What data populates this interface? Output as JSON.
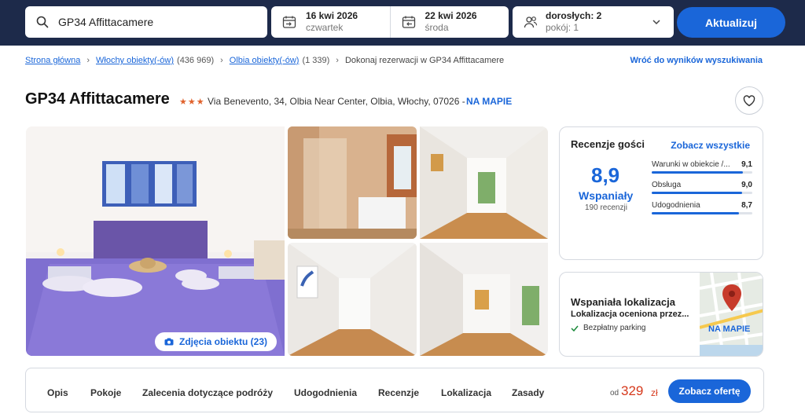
{
  "search": {
    "value": "GP34 Affittacamere",
    "icon": "search-icon"
  },
  "checkin": {
    "date": "16 kwi 2026",
    "day": "czwartek",
    "icon": "calendar-in-icon"
  },
  "checkout": {
    "date": "22 kwi 2026",
    "day": "środa",
    "icon": "calendar-out-icon"
  },
  "guests": {
    "adults": "dorosłych: 2",
    "rooms": "pokój: 1",
    "icon": "people-icon"
  },
  "update_button": "Aktualizuj",
  "breadcrumb": {
    "items": [
      {
        "label": "Strona główna",
        "count": ""
      },
      {
        "label": "Włochy obiekty(-ów)",
        "count": "(436 969)"
      },
      {
        "label": "Olbia obiekty(-ów)",
        "count": "(1 339)"
      }
    ],
    "current": "Dokonaj rezerwacji w GP34 Affittacamere"
  },
  "back_link": "Wróć do wyników wyszukiwania",
  "hotel": {
    "name": "GP34 Affittacamere",
    "stars": 3,
    "address": "Via Benevento, 34, Olbia Near Center, Olbia, Włochy, 07026 -",
    "map_link": "NA MAPIE"
  },
  "gallery": {
    "photos_button": "Zdjęcia obiektu (23)"
  },
  "reviews": {
    "heading": "Recenzje gości",
    "see_all": "Zobacz wszystkie",
    "score": "8,9",
    "rating_word": "Wspaniały",
    "count": "190 recenzji",
    "subscores": [
      {
        "label": "Warunki w obiekcie /...",
        "value": "9,1",
        "fraction": 0.91
      },
      {
        "label": "Obsługa",
        "value": "9,0",
        "fraction": 0.9
      },
      {
        "label": "Udogodnienia",
        "value": "8,7",
        "fraction": 0.87
      }
    ]
  },
  "location": {
    "title": "Wspaniała lokalizacja",
    "subtitle": "Lokalizacja oceniona przez...",
    "parking": "Bezpłatny parking",
    "map_label": "NA MAPIE"
  },
  "nav": {
    "items": [
      "Opis",
      "Pokoje",
      "Zalecenia dotyczące podróży",
      "Udogodnienia",
      "Recenzje",
      "Lokalizacja",
      "Zasady"
    ],
    "price_from": "od",
    "price": "329",
    "currency": "zł",
    "offer_button": "Zobacz ofertę"
  },
  "colors": {
    "brand_blue": "#1a66d9",
    "header_navy": "#1d2a4a",
    "price_red": "#d6391c",
    "star_orange": "#e0622c"
  }
}
